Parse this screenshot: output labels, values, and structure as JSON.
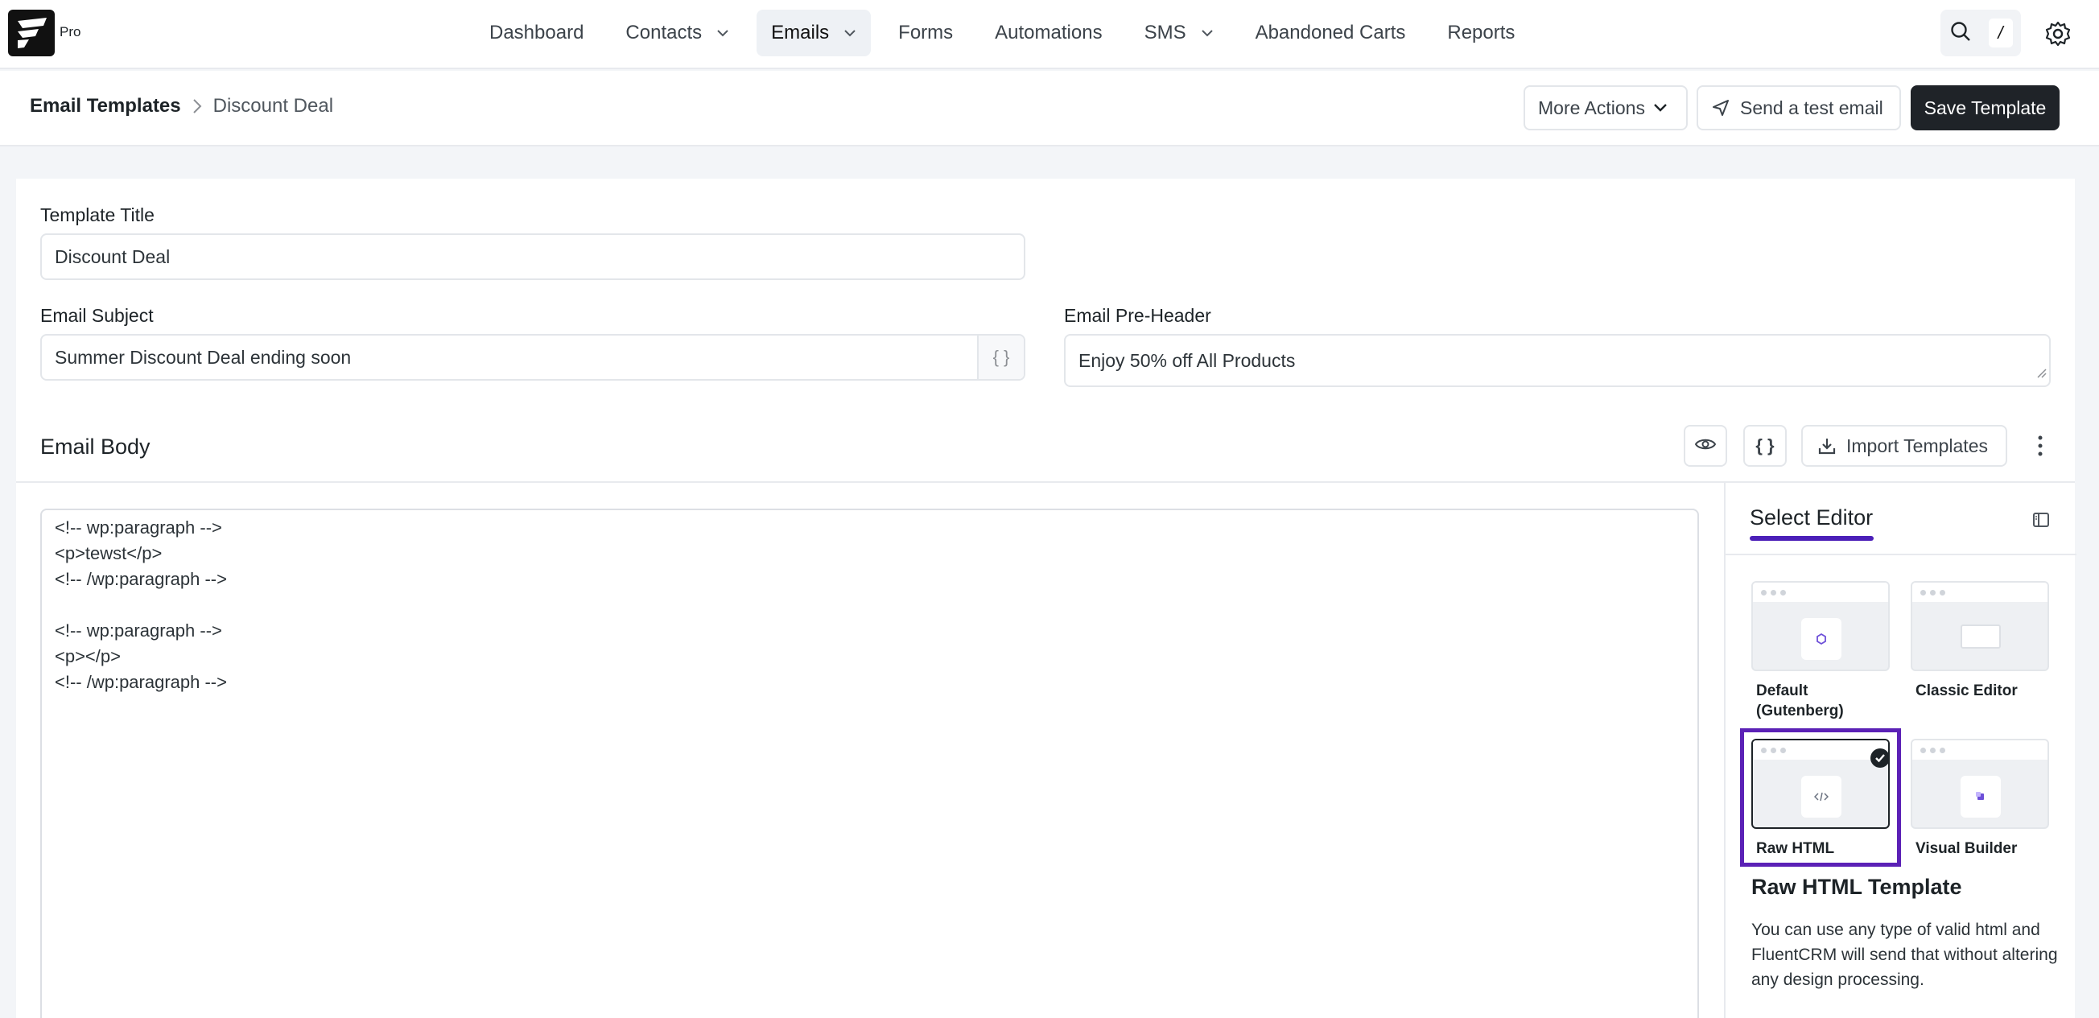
{
  "app": {
    "logo_badge": "Pro"
  },
  "nav": {
    "items": [
      {
        "label": "Dashboard",
        "dropdown": false,
        "active": false
      },
      {
        "label": "Contacts",
        "dropdown": true,
        "active": false
      },
      {
        "label": "Emails",
        "dropdown": true,
        "active": true
      },
      {
        "label": "Forms",
        "dropdown": false,
        "active": false
      },
      {
        "label": "Automations",
        "dropdown": false,
        "active": false
      },
      {
        "label": "SMS",
        "dropdown": true,
        "active": false
      },
      {
        "label": "Abandoned Carts",
        "dropdown": false,
        "active": false
      },
      {
        "label": "Reports",
        "dropdown": false,
        "active": false
      }
    ],
    "search_shortcut": "/"
  },
  "breadcrumb": {
    "root": "Email Templates",
    "current": "Discount Deal"
  },
  "actions": {
    "more_actions": "More Actions",
    "send_test": "Send a test email",
    "save": "Save Template"
  },
  "form": {
    "template_title_label": "Template Title",
    "template_title_value": "Discount Deal",
    "subject_label": "Email Subject",
    "subject_value": "Summer Discount Deal ending soon",
    "subject_addon": "{ }",
    "preheader_label": "Email Pre-Header",
    "preheader_value": "Enjoy 50% off All Products"
  },
  "email_body": {
    "title": "Email Body",
    "smartcode_label": "{ }",
    "import_label": "Import Templates",
    "code": "<!-- wp:paragraph -->\n<p>tewst</p>\n<!-- /wp:paragraph -->\n\n<!-- wp:paragraph -->\n<p></p>\n<!-- /wp:paragraph -->"
  },
  "editor_panel": {
    "title": "Select Editor",
    "options": [
      {
        "label": "Default (Gutenberg)",
        "selected": false
      },
      {
        "label": "Classic Editor",
        "selected": false
      },
      {
        "label": "Raw HTML",
        "selected": true
      },
      {
        "label": "Visual Builder",
        "selected": false
      }
    ],
    "selected_heading": "Raw HTML Template",
    "selected_description": "You can use any type of valid html and FluentCRM will send that without altering any design processing."
  },
  "colors": {
    "accent": "#5b21b6",
    "primary_button": "#1f2328"
  }
}
